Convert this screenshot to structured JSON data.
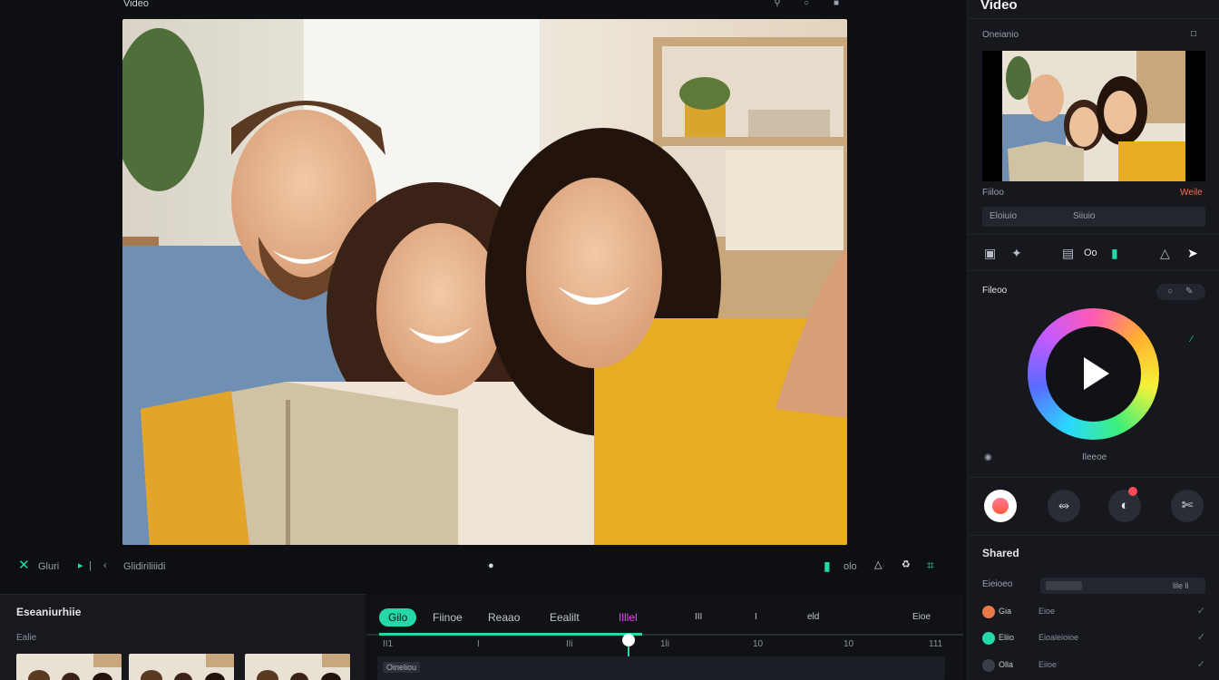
{
  "top": {
    "title": "Video",
    "icons": [
      "search-icon",
      "tag-icon",
      "window-icon"
    ]
  },
  "transport": {
    "left_label": "Gluri",
    "timecode": "Glidiriliiidi",
    "right_label": "olo"
  },
  "library": {
    "title": "Eseaniurhiie",
    "subtitle": "Ealie"
  },
  "timeline": {
    "tabs": [
      {
        "label": "Gilo"
      },
      {
        "label": "Fiinoe"
      },
      {
        "label": "Reaao"
      },
      {
        "label": "Eealilt"
      },
      {
        "label": "Illlel"
      }
    ],
    "extra_labels": [
      "III",
      "I",
      "eld",
      "Eioe"
    ],
    "ruler": [
      "II1",
      "I",
      "IIi",
      "1li",
      "10",
      "10",
      "111"
    ],
    "track_label": "Oineliou"
  },
  "panel": {
    "title": "Video",
    "section_label": "Oneianio",
    "meta_left": "Fiiloo",
    "meta_right": "Weile",
    "field_left": "Eloiuio",
    "field_right": "Siiuio",
    "toolbar_text": "Oo",
    "color_label": "Fileoo",
    "ring_caption": "Ileeoe",
    "shared_title": "Shared",
    "slider_label": "Eieioeo",
    "slider_value": "lile li",
    "rows": [
      {
        "label": "Gia",
        "value": "Eioe",
        "color": "#e87a4a"
      },
      {
        "label": "Eliio",
        "value": "Eioaleioioe",
        "color": "#25d8a8"
      },
      {
        "label": "Olla",
        "value": "Eiioe",
        "color": "#8b9099"
      }
    ]
  },
  "colors": {
    "accent": "#25d8a8",
    "magenta": "#e052f0",
    "alert": "#ff4a5a"
  }
}
